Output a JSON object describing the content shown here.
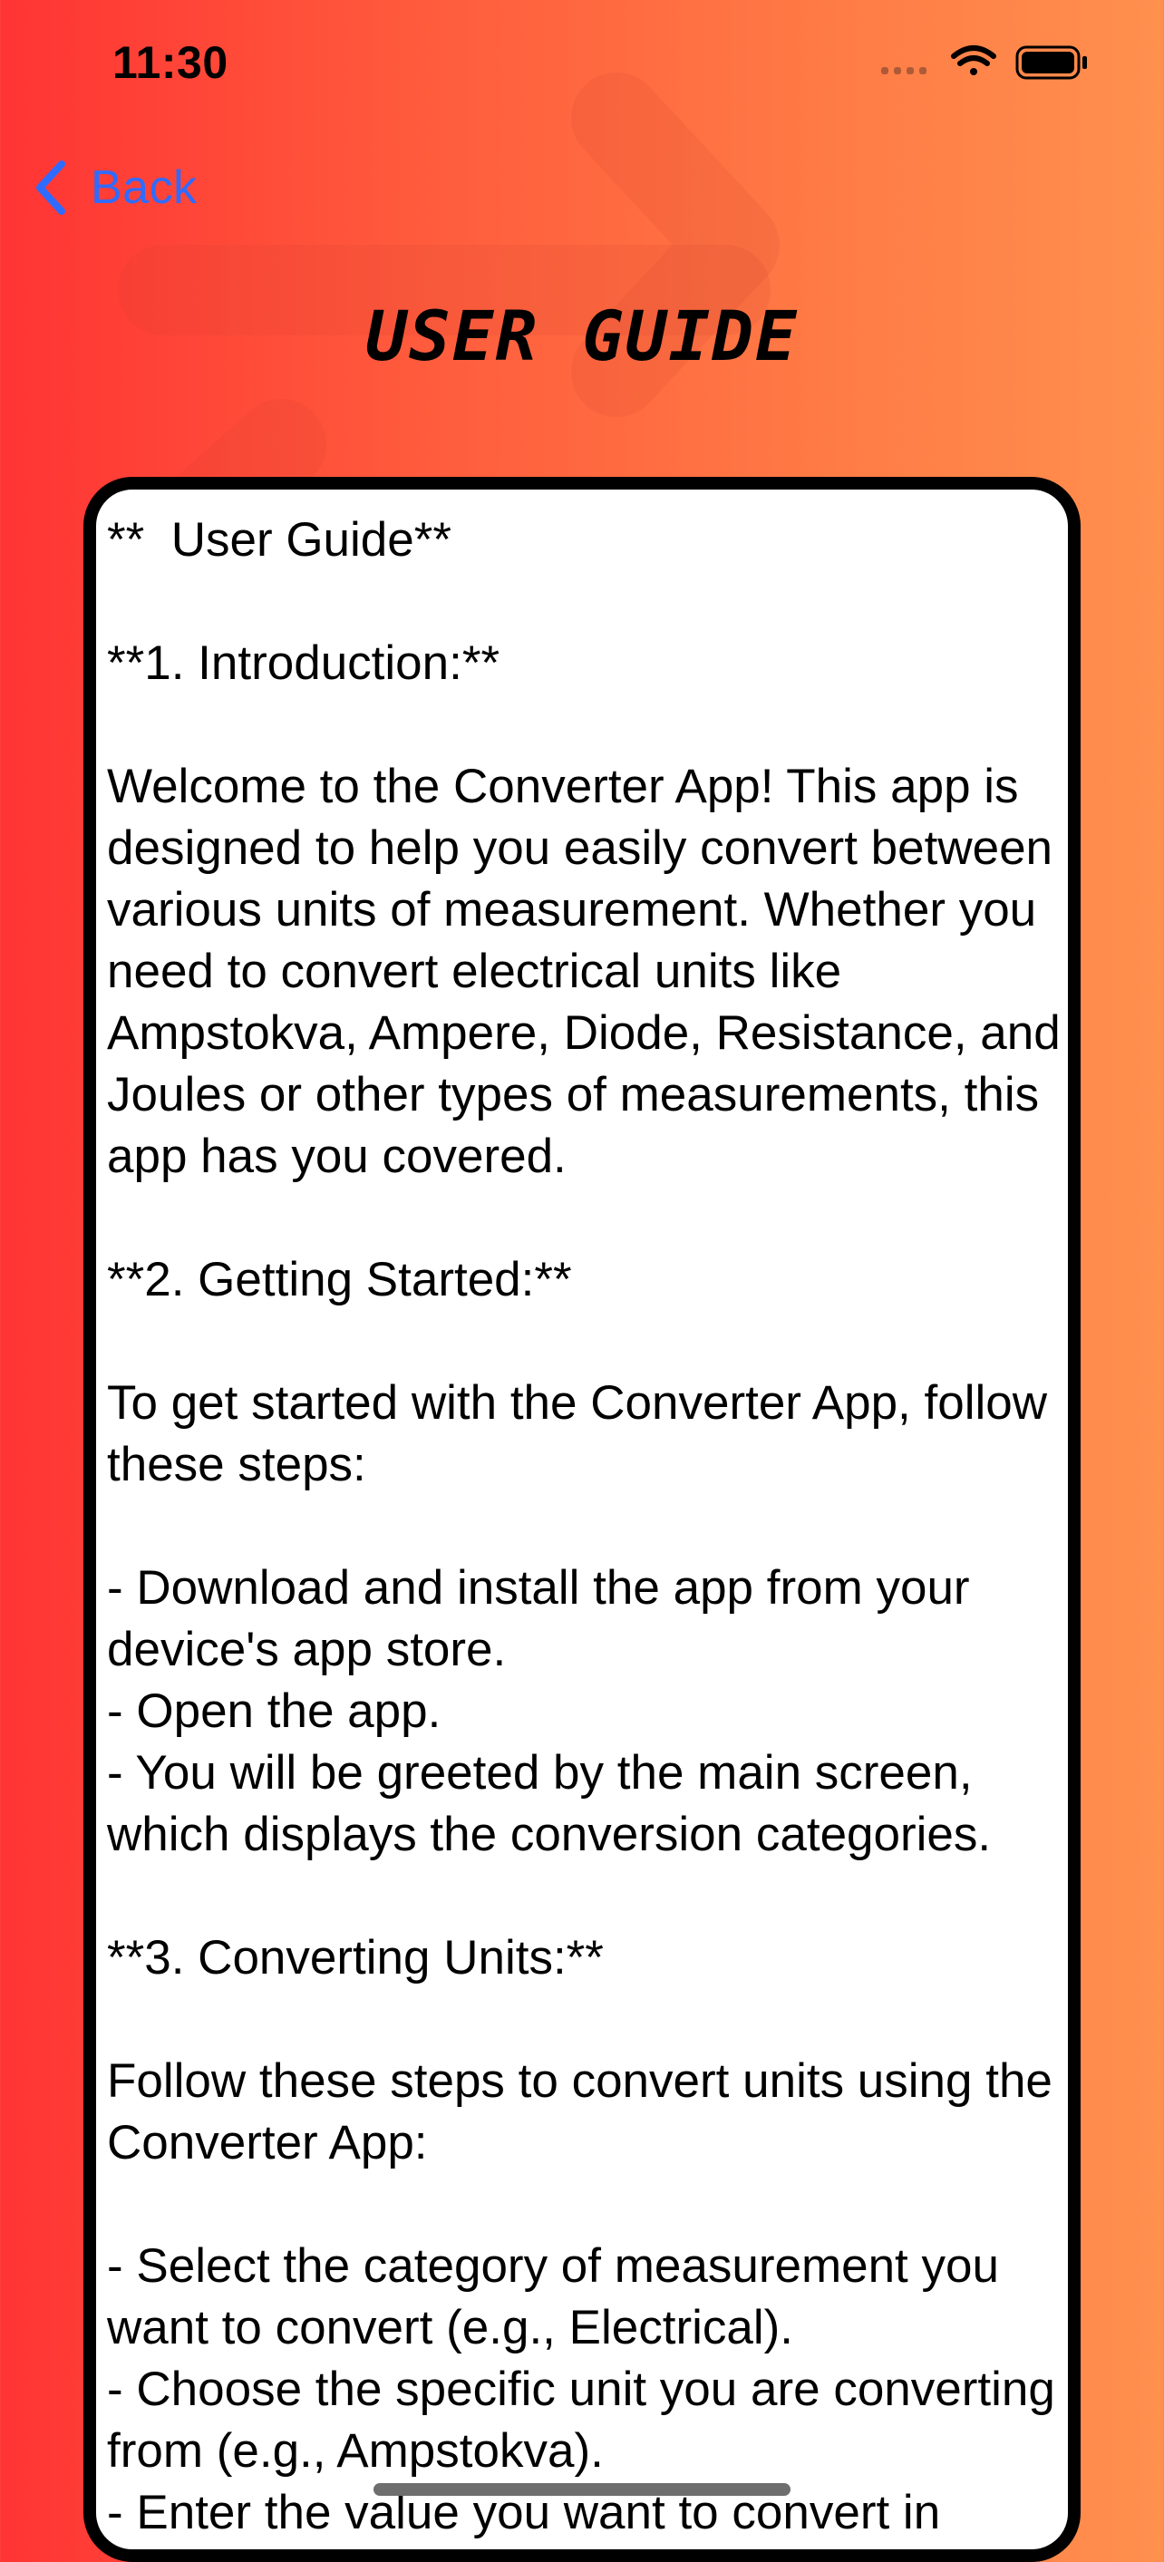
{
  "status_bar": {
    "time": "11:30",
    "icons": [
      "cellular-signal-icon",
      "wifi-icon",
      "battery-icon"
    ]
  },
  "nav": {
    "back_label": "Back",
    "back_icon": "chevron-left-icon",
    "accent_color": "#2F6BFF"
  },
  "title": "USER GUIDE",
  "guide": {
    "text": "**  User Guide**\n\n**1. Introduction:**\n\nWelcome to the Converter App! This app is designed to help you easily convert between various units of measurement. Whether you need to convert electrical units like Ampstokva, Ampere, Diode, Resistance, and Joules or other types of measurements, this app has you covered.\n\n**2. Getting Started:**\n\nTo get started with the Converter App, follow these steps:\n\n- Download and install the app from your device's app store.\n- Open the app.\n- You will be greeted by the main screen, which displays the conversion categories.\n\n**3. Converting Units:**\n\nFollow these steps to convert units using the Converter App:\n\n- Select the category of measurement you want to convert (e.g., Electrical).\n- Choose the specific unit you are converting from (e.g., Ampstokva).\n- Enter the value you want to convert in"
  },
  "colors": {
    "gradient_start": "#FF3434",
    "gradient_end": "#FF904E",
    "card_background": "#FFFFFF",
    "card_border": "#000000"
  }
}
